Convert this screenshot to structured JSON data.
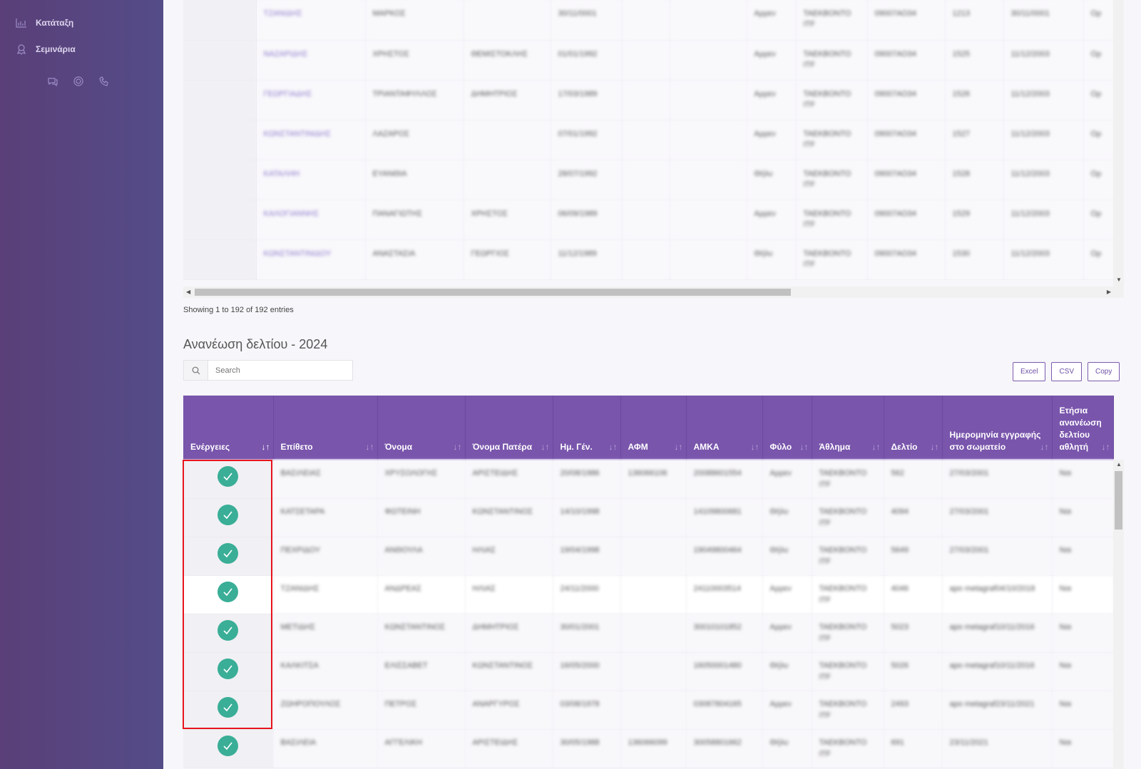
{
  "sidebar": {
    "items": [
      {
        "label": "Κατάταξη",
        "icon": "bar-chart-icon"
      },
      {
        "label": "Σεμινάρια",
        "icon": "award-icon"
      }
    ],
    "footer_icons": [
      "chat-icon",
      "lifebuoy-icon",
      "phone-icon"
    ],
    "gradient": [
      "#5a3f78",
      "#544c88"
    ]
  },
  "top_table": {
    "rows": [
      [
        "",
        "ΤΖΑΝΙΔΗΣ",
        "ΜΑΡΚΟΣ",
        "",
        "30/11/0001",
        "",
        "",
        "Αρρεν",
        "ΤΑΕΚΒΟΝΤΟ ITF",
        "09007ΑΟ34",
        "1213",
        "30/11/0001",
        "Ορ"
      ],
      [
        "",
        "ΝΑΖΑΡΙΔΗΣ",
        "ΧΡΗΣΤΟΣ",
        "ΘΕΜΙΣΤΟΚΛΗΣ",
        "01/01/1992",
        "",
        "",
        "Αρρεν",
        "ΤΑΕΚΒΟΝΤΟ ITF",
        "09007ΑΟ34",
        "1525",
        "11/12/2003",
        "Ορ"
      ],
      [
        "",
        "ΓΕΩΡΓΙΑΔΗΣ",
        "ΤΡΙΑΝΤΑΦΥΛΛΟΣ",
        "ΔΗΜΗΤΡΙΟΣ",
        "17/03/1989",
        "",
        "",
        "Αρρεν",
        "ΤΑΕΚΒΟΝΤΟ ITF",
        "09007ΑΟ34",
        "1526",
        "11/12/2003",
        "Ορ"
      ],
      [
        "",
        "ΚΩΝΣΤΑΝΤΙΝΙΔΗΣ",
        "ΛΑΖΑΡΟΣ",
        "",
        "07/01/1992",
        "",
        "",
        "Αρρεν",
        "ΤΑΕΚΒΟΝΤΟ ITF",
        "09007ΑΟ34",
        "1527",
        "11/12/2003",
        "Ορ"
      ],
      [
        "",
        "ΚΑΤΑΛΗΗ",
        "ΕΥΑΝΘΙΑ",
        "",
        "28/07/1992",
        "",
        "",
        "Θήλυ",
        "ΤΑΕΚΒΟΝΤΟ ITF",
        "09007ΑΟ34",
        "1528",
        "11/12/2003",
        "Ορ"
      ],
      [
        "",
        "ΚΑΛΟΓΙΑΝΝΗΣ",
        "ΠΑΝΑΓΙΩΤΗΣ",
        "ΧΡΗΣΤΟΣ",
        "06/09/1989",
        "",
        "",
        "Αρρεν",
        "ΤΑΕΚΒΟΝΤΟ ITF",
        "09007ΑΟ34",
        "1529",
        "11/12/2003",
        "Ορ"
      ],
      [
        "",
        "ΚΩΝΣΤΑΝΤΙΝΙΔΟΥ",
        "ΑΝΑΣΤΑΣΙΑ",
        "ΓΕΩΡΓΙΟΣ",
        "11/12/1989",
        "",
        "",
        "Θήλυ",
        "ΤΑΕΚΒΟΝΤΟ ITF",
        "09007ΑΟ34",
        "1530",
        "11/12/2003",
        "Ορ"
      ]
    ]
  },
  "showing": "Showing 1 to 192 of 192 entries",
  "section_title": "Ανανέωση δελτίου - 2024",
  "search": {
    "placeholder": "Search",
    "value": ""
  },
  "export_buttons": {
    "excel": "Excel",
    "csv": "CSV",
    "copy": "Copy"
  },
  "accent": "#7955ac",
  "check_color": "#3aae97",
  "highlight_color": "#e8141c",
  "bottom_table": {
    "headers": [
      "Ενέργειες",
      "Επίθετο",
      "Όνομα",
      "Όνομα Πατέρα",
      "Ημ. Γέν.",
      "ΑΦΜ",
      "ΑΜΚΑ",
      "Φύλο",
      "Άθλημα",
      "Δελτίο",
      "Ημερομηνία εγγραφής στο σωματείο",
      "Ετήσια ανανέωση δελτίου αθλητή"
    ],
    "rows": [
      [
        "ΒΑΣΙΛΕΙΑΣ",
        "ΧΡΥΣΟΛΟΓΗΣ",
        "ΑΡΙΣΤΕΙΔΗΣ",
        "20/08/1986",
        "136066106",
        "20088601554",
        "Αρρεν",
        "ΤΑΕΚΒΟΝΤΟ ITF",
        "562",
        "27/03/2001",
        "Ναι"
      ],
      [
        "ΚΑΤΣΕΤΑΡΑ",
        "ΦΩΤΕΙΝΗ",
        "ΚΩΝΣΤΑΝΤΙΝΟΣ",
        "14/10/1998",
        "",
        "14109800681",
        "Θήλυ",
        "ΤΑΕΚΒΟΝΤΟ ITF",
        "4094",
        "27/03/2001",
        "Ναι"
      ],
      [
        "ΠΕΧΡΙΔΟΥ",
        "ΑΝΘΟΥΛΑ",
        "ΗΛΙΑΣ",
        "19/04/1998",
        "",
        "19049800464",
        "Θήλυ",
        "ΤΑΕΚΒΟΝΤΟ ITF",
        "5649",
        "27/03/2001",
        "Ναι"
      ],
      [
        "ΤΖΑΝΙΔΗΣ",
        "ΑΝΔΡΕΑΣ",
        "ΗΛΙΑΣ",
        "24/11/2000",
        "",
        "24110003514",
        "Αρρεν",
        "ΤΑΕΚΒΟΝΤΟ ITF",
        "4046",
        "apo metagraf04/10/2018",
        "Ναι"
      ],
      [
        "ΜΕΤΙΔΗΣ",
        "ΚΩΝΣΤΑΝΤΙΝΟΣ",
        "ΔΗΜΗΤΡΙΟΣ",
        "30/01/2001",
        "",
        "30010101852",
        "Αρρεν",
        "ΤΑΕΚΒΟΝΤΟ ITF",
        "5023",
        "apo metagraf10/11/2016",
        "Ναι"
      ],
      [
        "ΚΑΛΚΙΤΣΑ",
        "ΕΛΙΣΣΑΒΕΤ",
        "ΚΩΝΣΤΑΝΤΙΝΟΣ",
        "16/05/2000",
        "",
        "16050001480",
        "Θήλυ",
        "ΤΑΕΚΒΟΝΤΟ ITF",
        "5026",
        "apo metagraf10/11/2016",
        "Ναι"
      ],
      [
        "ΖΩΗΡΟΠΟΥΛΟΣ",
        "ΠΕΤΡΟΣ",
        "ΑΝΑΡΓΥΡΟΣ",
        "03/08/1978",
        "",
        "03087804165",
        "Αρρεν",
        "ΤΑΕΚΒΟΝΤΟ ITF",
        "2493",
        "apo metagraf23/11/2021",
        "Ναι"
      ],
      [
        "ΒΑΣΙΛΕΙΑ",
        "ΑΓΓΕΛΙΚΗ",
        "ΑΡΙΣΤΕΙΔΗΣ",
        "30/05/1988",
        "136066099",
        "30058801662",
        "Θήλυ",
        "ΤΑΕΚΒΟΝΤΟ ITF",
        "691",
        "23/11/2021",
        "Ναι"
      ]
    ]
  }
}
